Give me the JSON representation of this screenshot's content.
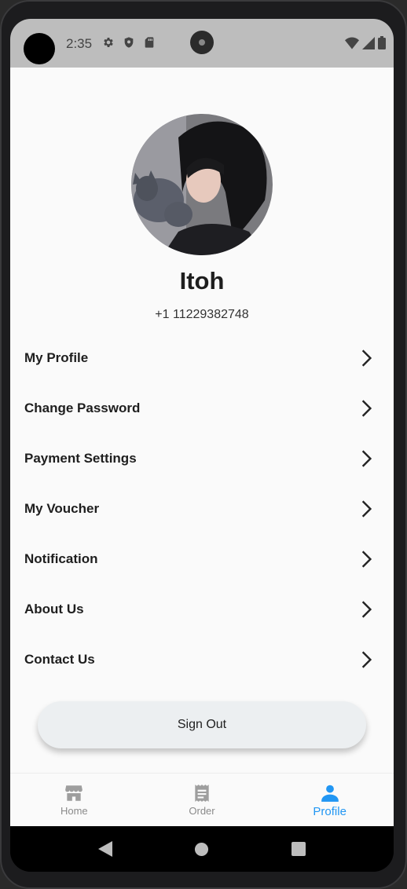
{
  "status_bar": {
    "time": "2:35",
    "left_icons": [
      "gear-icon",
      "shield-icon",
      "sd-card-icon"
    ],
    "right_icons": [
      "wifi-icon",
      "signal-icon",
      "battery-icon"
    ]
  },
  "profile": {
    "name": "Itoh",
    "phone": "+1 11229382748"
  },
  "menu": {
    "items": [
      {
        "label": "My Profile"
      },
      {
        "label": "Change Password"
      },
      {
        "label": "Payment Settings"
      },
      {
        "label": "My Voucher"
      },
      {
        "label": "Notification"
      },
      {
        "label": "About Us"
      },
      {
        "label": "Contact Us"
      }
    ]
  },
  "sign_out": {
    "label": "Sign Out"
  },
  "bottom_nav": {
    "items": [
      {
        "label": "Home",
        "icon": "store-icon"
      },
      {
        "label": "Order",
        "icon": "receipt-icon"
      },
      {
        "label": "Profile",
        "icon": "person-icon",
        "active": true
      }
    ]
  },
  "colors": {
    "accent": "#2196f3",
    "status_bar": "#bdbdbd",
    "background": "#fafafa"
  }
}
